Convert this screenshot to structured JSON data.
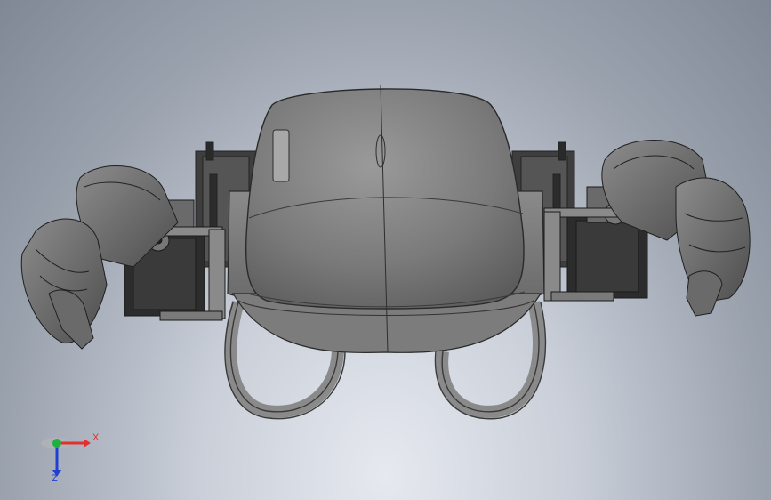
{
  "viewport": {
    "background": "#9aa2ae",
    "model": "robot-assembly"
  },
  "triad": {
    "x_label": "X",
    "y_label": "",
    "z_label": "Z",
    "x_color": "#e03030",
    "y_color": "#20b040",
    "z_color": "#2040d0"
  }
}
